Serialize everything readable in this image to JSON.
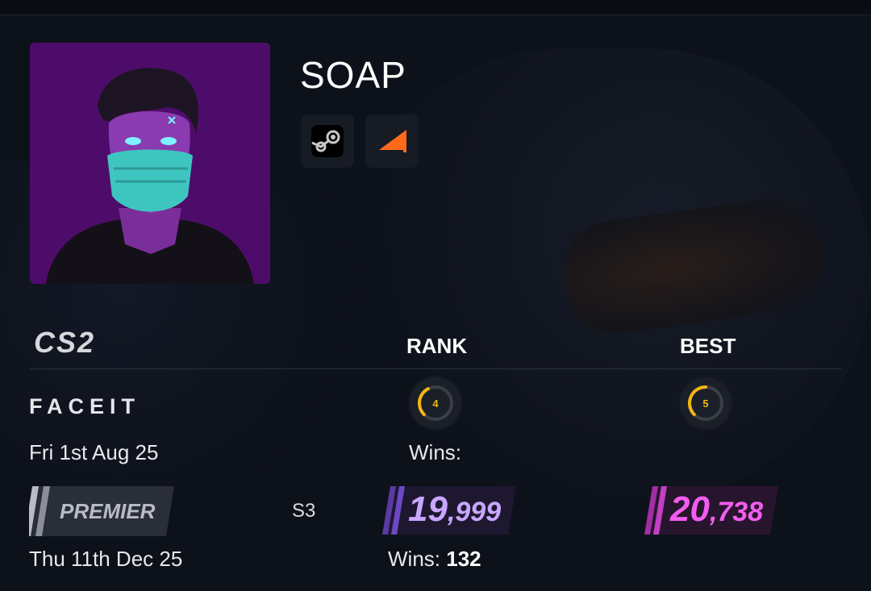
{
  "profile": {
    "name": "SOAP",
    "social": [
      {
        "icon": "steam-icon"
      },
      {
        "icon": "faceit-icon"
      }
    ]
  },
  "table": {
    "game_logo_text": "CS2",
    "rank_header": "RANK",
    "best_header": "BEST"
  },
  "faceit": {
    "logo_text": "FACEIT",
    "date": "Fri 1st Aug 25",
    "wins_label": "Wins:",
    "rank_level": "4",
    "best_level": "5",
    "rank_level_fraction": 0.4,
    "best_level_fraction": 0.5,
    "level_color": "#f2b712"
  },
  "premier": {
    "logo_text": "PREMIER",
    "season": "S3",
    "date": "Thu 11th Dec 25",
    "wins_label": "Wins:",
    "wins_value": "132",
    "rank_rating_major": "19",
    "rank_rating_minor": ",999",
    "best_rating_major": "20",
    "best_rating_minor": ",738",
    "rank_color": "#c9a6ff",
    "best_color": "#f45cf0"
  }
}
